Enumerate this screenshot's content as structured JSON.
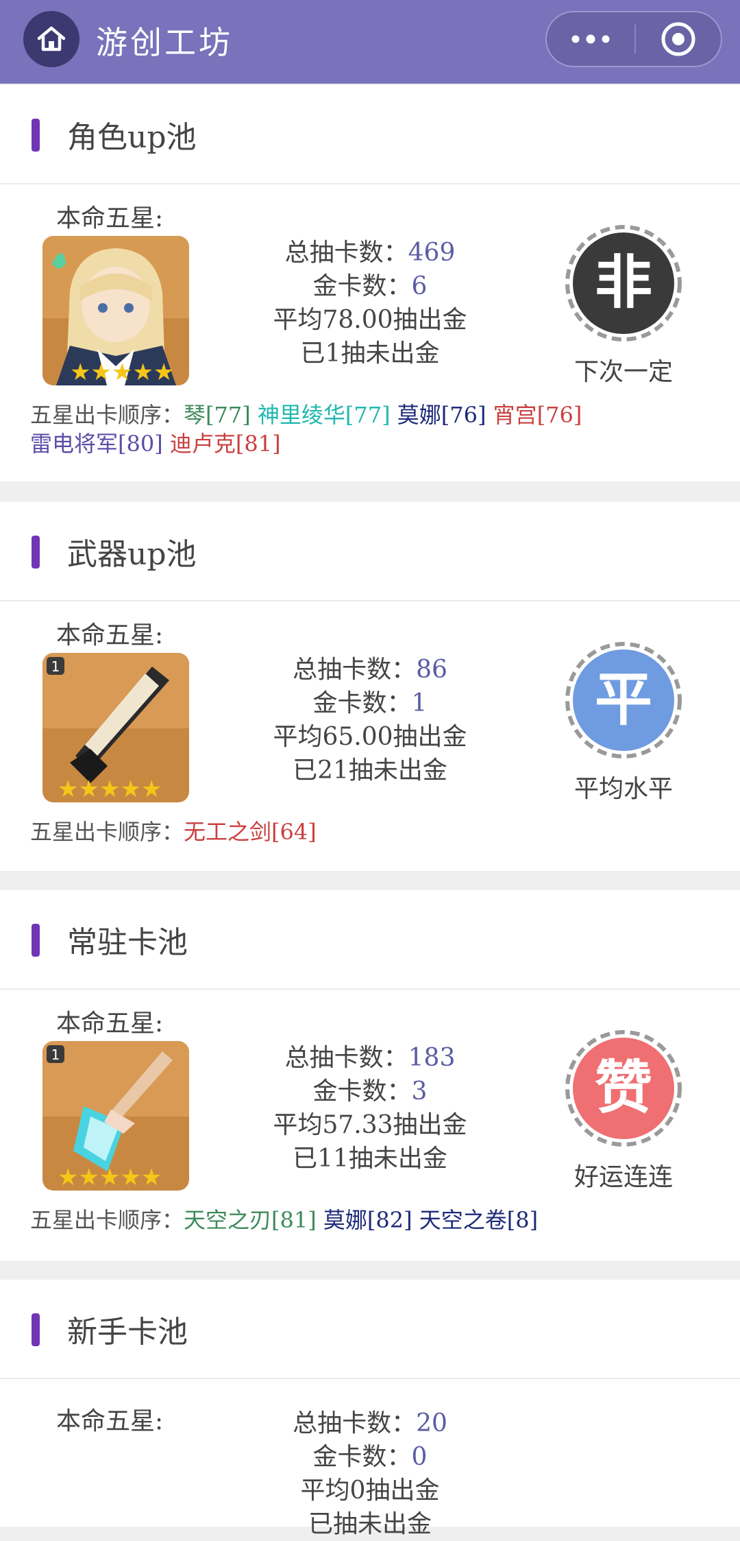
{
  "header": {
    "title": "游创工坊"
  },
  "common": {
    "main_label": "本命五星:",
    "total_label": "总抽卡数：",
    "gold_label": "金卡数：",
    "avg_prefix": "平均",
    "avg_suffix": "抽出金",
    "since_prefix": "已",
    "since_suffix": "抽未出金",
    "order_label": "五星出卡顺序："
  },
  "pools": [
    {
      "title": "角色up池",
      "total": "469",
      "gold": "6",
      "avg": "78.00",
      "since": "1",
      "badge": "非",
      "badge_color": "#3a3a3a",
      "verdict": "下次一定",
      "order": [
        {
          "text": "琴[77]",
          "color": "#3c8a5a"
        },
        {
          "text": "神里绫华[77]",
          "color": "#1fb8b0"
        },
        {
          "text": "莫娜[76]",
          "color": "#1d2a78"
        },
        {
          "text": "宵宫[76]",
          "color": "#c9403f"
        },
        {
          "text": "雷电将军[80]",
          "color": "#5a4ea8"
        },
        {
          "text": "迪卢克[81]",
          "color": "#c9403f"
        }
      ]
    },
    {
      "title": "武器up池",
      "total": "86",
      "gold": "1",
      "avg": "65.00",
      "since": "21",
      "badge": "平",
      "badge_color": "#6f9be0",
      "verdict": "平均水平",
      "order": [
        {
          "text": "无工之剑[64]",
          "color": "#c9403f"
        }
      ]
    },
    {
      "title": "常驻卡池",
      "total": "183",
      "gold": "3",
      "avg": "57.33",
      "since": "11",
      "badge": "赞",
      "badge_color": "#ef6f72",
      "verdict": "好运连连",
      "order": [
        {
          "text": "天空之刃[81]",
          "color": "#3c8a5a"
        },
        {
          "text": "莫娜[82]",
          "color": "#1d2a78"
        },
        {
          "text": "天空之卷[8]",
          "color": "#1d2a78"
        }
      ]
    },
    {
      "title": "新手卡池",
      "total": "20",
      "gold": "0",
      "avg": "0",
      "since": ""
    }
  ]
}
